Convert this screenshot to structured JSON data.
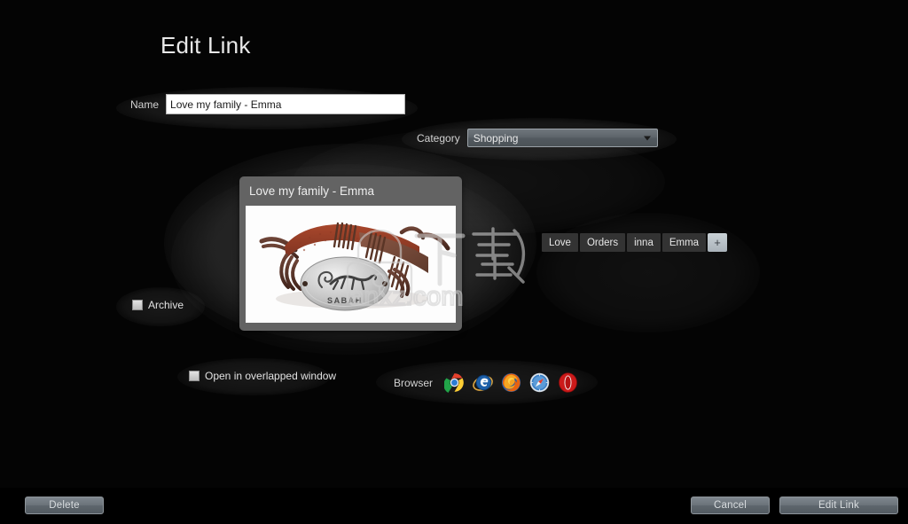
{
  "window": {
    "title": "Edit Link",
    "background_color": "#040404"
  },
  "form": {
    "name": {
      "label": "Name",
      "value": "Love my family - Emma",
      "placeholder": "Name"
    },
    "category": {
      "label": "Category",
      "selected": "Shopping"
    },
    "archive": {
      "label": "Archive",
      "checked": false
    },
    "overlapped_window": {
      "label": "Open in overlapped window",
      "checked": false
    },
    "browser": {
      "label": "Browser",
      "options": [
        {
          "name": "chrome-icon",
          "label": "Chrome"
        },
        {
          "name": "internet-explorer-icon",
          "label": "Internet Explorer"
        },
        {
          "name": "firefox-icon",
          "label": "Firefox"
        },
        {
          "name": "safari-icon",
          "label": "Safari"
        },
        {
          "name": "opera-icon",
          "label": "Opera"
        }
      ]
    }
  },
  "preview": {
    "title": "Love my family - Emma",
    "image_alt": "Brown leather bracelet with silver oval pendant engraved SABAH",
    "pendant_text": "SABAH"
  },
  "tags": {
    "items": [
      "Love",
      "Orders",
      "inna",
      "Emma"
    ],
    "add_label": "+"
  },
  "watermark": {
    "chinese_text": "下载",
    "site": "anxz.com",
    "icon": "padlock-icon"
  },
  "footer": {
    "delete_label": "Delete",
    "cancel_label": "Cancel",
    "primary_label": "Edit Link"
  },
  "colors": {
    "accent": "#aab3ba",
    "card": "#636363",
    "input_bg": "#ffffff",
    "tag_bg": "#333333",
    "button_bg": "#6b737a"
  }
}
